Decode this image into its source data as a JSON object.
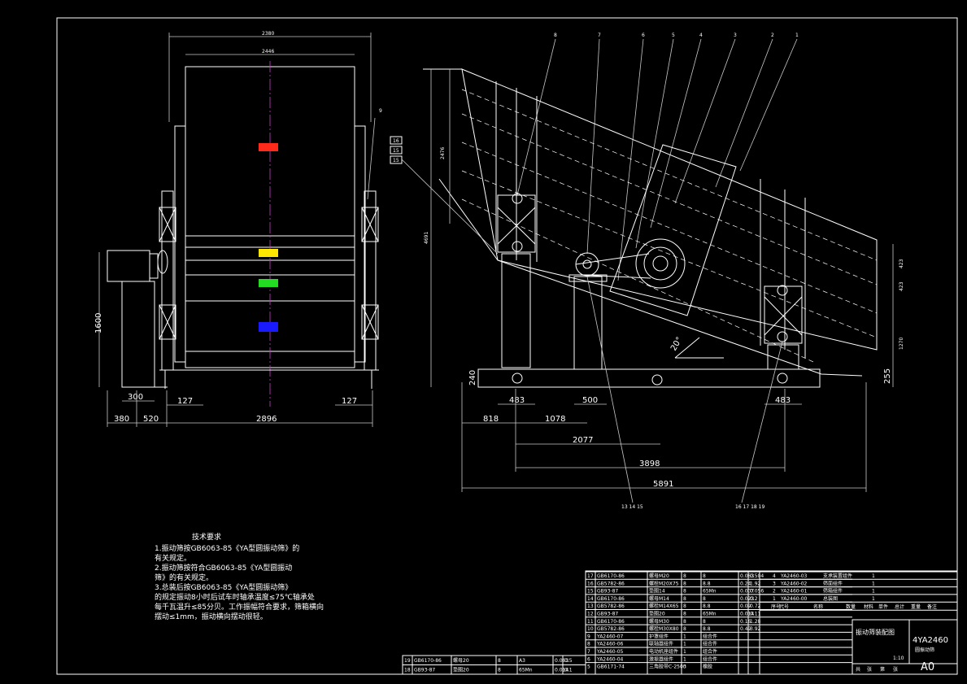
{
  "colors": {
    "background": "#000000",
    "line": "#ffffff",
    "centerline": "#c83cc8",
    "mark_red": "#ff2a1a",
    "mark_yellow": "#ffe600",
    "mark_green": "#22dd22",
    "mark_blue": "#1a1aff"
  },
  "front_view": {
    "dims": {
      "top_outer": "2380",
      "top_inner": "2446",
      "height": "1600",
      "motor_base": "300",
      "left_127": "127",
      "right_127": "127",
      "bottom_380": "380",
      "bottom_520": "520",
      "bottom_total": "2896"
    },
    "balloon_9": "9"
  },
  "side_view": {
    "balloons": [
      "8",
      "7",
      "6",
      "5",
      "4",
      "3",
      "2",
      "1"
    ],
    "left_balloons": [
      "16",
      "15",
      "15"
    ],
    "dims": {
      "h_2476": "2476",
      "h_4691": "4691",
      "h_240": "240",
      "foot_l": "483",
      "foot_m": "500",
      "foot_r": "483",
      "d_818": "818",
      "d_1078": "1078",
      "d_2077": "2077",
      "d_3898": "3898",
      "d_5891": "5891",
      "r_423a": "423",
      "r_423b": "423",
      "r_1270": "1270",
      "r_255": "255",
      "angle": "20°"
    },
    "bottom_labels": {
      "left": "13 14 15",
      "right": "16 17 18 19"
    }
  },
  "tech": {
    "title": "技术要求",
    "items": [
      "1.振动筛按GB6063-85《YA型圆振动筛》的",
      "   有关规定。",
      "2.振动筛按符合GB6063-85《YA型圆振动",
      "   筛》的有关规定。",
      "3.总装后按GB6063-85《YA型圆振动筛》",
      "   的规定振动8小时后试车时轴承温度≤75℃轴承处",
      "   每千瓦温升≤85分贝。工作振幅符合要求，筛箱横向",
      "   摆动≤1mm，振动横向摆动很轻。"
    ]
  },
  "bom": {
    "rows": [
      [
        "17",
        "GB6170-86",
        "螺母M20",
        "8",
        "8",
        "0.063",
        "0.504"
      ],
      [
        "16",
        "GB5782-86",
        "螺栓M20X75",
        "8",
        "8.8",
        "0.24",
        "1.92"
      ],
      [
        "15",
        "GB93-87",
        "垫圈14",
        "8",
        "65Mn",
        "0.007",
        "0.056"
      ],
      [
        "14",
        "GB6170-86",
        "螺母M14",
        "8",
        "8",
        "0.023",
        "0.2"
      ],
      [
        "13",
        "GB5782-86",
        "螺栓M14X65",
        "8",
        "8.8",
        "0.09",
        "0.72"
      ],
      [
        "12",
        "GB93-87",
        "垫圈20",
        "8",
        "65Mn",
        "0.014",
        "0.11"
      ],
      [
        "11",
        "GB6170-86",
        "螺母M30",
        "8",
        "8",
        "0.16",
        "1.28"
      ],
      [
        "10",
        "GB5782-86",
        "螺栓M30X80",
        "8",
        "8.8",
        "0.49",
        "3.92"
      ],
      [
        "9",
        "YA2460-07",
        "护罩组件",
        "1",
        "组合件",
        "",
        ""
      ],
      [
        "8",
        "YA2460-06",
        "联轴器组件",
        "1",
        "组合件",
        "",
        ""
      ],
      [
        "7",
        "YA2460-05",
        "电动机座组件",
        "1",
        "组合件",
        "",
        ""
      ],
      [
        "6",
        "YA2460-04",
        "激振器组件",
        "1",
        "组合件",
        "",
        ""
      ],
      [
        "5",
        "GB6171-74",
        "三角胶带C-2500",
        "3",
        "橡胶",
        "",
        ""
      ]
    ],
    "extra_rows": [
      [
        "19",
        "GB6170-86",
        "螺母20",
        "8",
        "A3",
        "0.063",
        "0.5"
      ],
      [
        "18",
        "GB93-87",
        "垫圈20",
        "8",
        "65Mn",
        "0.014",
        "0.1"
      ]
    ],
    "right_rows": [
      [
        "4",
        "YA2460-03",
        "支承装置组件",
        "1"
      ],
      [
        "3",
        "YA2460-02",
        "筛面组件",
        "1"
      ],
      [
        "2",
        "YA2460-01",
        "筛箱组件",
        "1"
      ],
      [
        "1",
        "YA2460-00",
        "总装图",
        "1"
      ]
    ],
    "header": [
      "序号",
      "代号",
      "名称",
      "数量",
      "材料",
      "单件",
      "总计",
      "重量",
      "备注"
    ],
    "title": "振动筛装配图",
    "code": "4YA2460",
    "sub": "圆振动筛",
    "scale": "1:10",
    "size": "A0",
    "footer": [
      "共",
      "张",
      "第",
      "张"
    ]
  }
}
